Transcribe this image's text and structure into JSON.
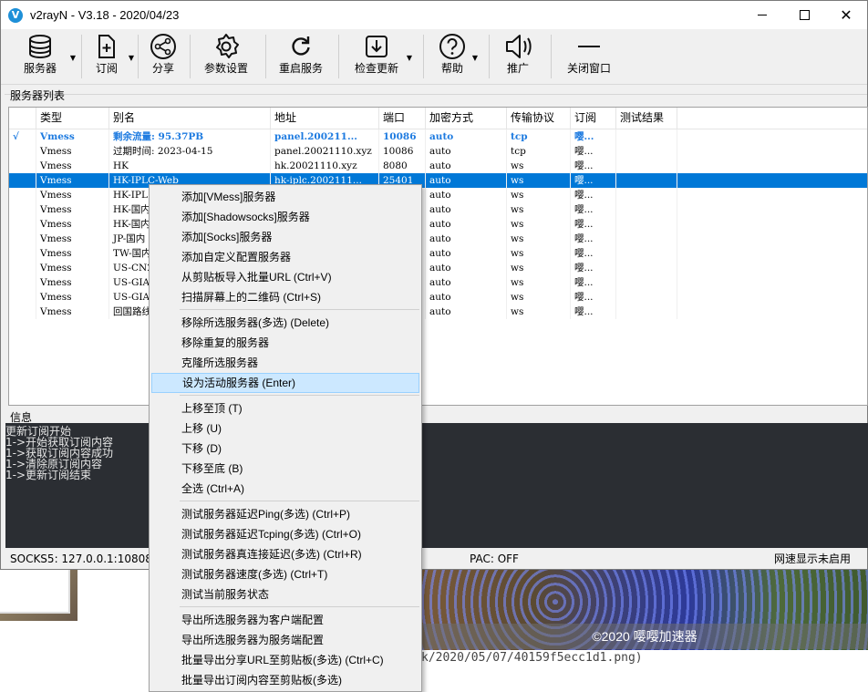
{
  "window": {
    "title": "v2rayN - V3.18 - 2020/04/23",
    "icon_letter": "V"
  },
  "toolbar": [
    {
      "label": "服务器",
      "icon": "database-icon",
      "dropdown": true
    },
    {
      "label": "订阅",
      "icon": "subscribe-icon",
      "dropdown": true
    },
    {
      "label": "分享",
      "icon": "share-icon",
      "dropdown": false
    },
    {
      "label": "参数设置",
      "icon": "gear-icon",
      "dropdown": false
    },
    {
      "label": "重启服务",
      "icon": "refresh-icon",
      "dropdown": false
    },
    {
      "label": "检查更新",
      "icon": "download-icon",
      "dropdown": true
    },
    {
      "label": "帮助",
      "icon": "help-icon",
      "dropdown": true
    },
    {
      "label": "推广",
      "icon": "speaker-icon",
      "dropdown": false
    },
    {
      "label": "关闭窗口",
      "icon": "minus-icon",
      "dropdown": false
    }
  ],
  "server_list": {
    "label": "服务器列表",
    "columns": [
      "",
      "类型",
      "别名",
      "地址",
      "端口",
      "加密方式",
      "传输协议",
      "订阅",
      "测试结果"
    ],
    "rows": [
      {
        "mark": "√",
        "type": "Vmess",
        "alias": "剩余流量: 95.37PB",
        "address": "panel.200211...",
        "port": "10086",
        "security": "auto",
        "network": "tcp",
        "sub": "嘤...",
        "test": "",
        "state": "active"
      },
      {
        "mark": "",
        "type": "Vmess",
        "alias": "过期时间: 2023-04-15",
        "address": "panel.20021110.xyz",
        "port": "10086",
        "security": "auto",
        "network": "tcp",
        "sub": "嘤...",
        "test": "",
        "state": ""
      },
      {
        "mark": "",
        "type": "Vmess",
        "alias": "HK",
        "address": "hk.20021110.xyz",
        "port": "8080",
        "security": "auto",
        "network": "ws",
        "sub": "嘤...",
        "test": "",
        "state": ""
      },
      {
        "mark": "",
        "type": "Vmess",
        "alias": "HK-IPLC-Web",
        "address": "hk-iplc.2002111...",
        "port": "25401",
        "security": "auto",
        "network": "ws",
        "sub": "嘤...",
        "test": "",
        "state": "selected"
      },
      {
        "mark": "",
        "type": "Vmess",
        "alias": "HK-IPL",
        "address": "",
        "port": "",
        "security": "auto",
        "network": "ws",
        "sub": "嘤...",
        "test": "",
        "state": ""
      },
      {
        "mark": "",
        "type": "Vmess",
        "alias": "HK-国内",
        "address": "",
        "port": "",
        "security": "auto",
        "network": "ws",
        "sub": "嘤...",
        "test": "",
        "state": ""
      },
      {
        "mark": "",
        "type": "Vmess",
        "alias": "HK-国内",
        "address": "",
        "port": "",
        "security": "auto",
        "network": "ws",
        "sub": "嘤...",
        "test": "",
        "state": ""
      },
      {
        "mark": "",
        "type": "Vmess",
        "alias": "JP-国内",
        "address": "",
        "port": "",
        "security": "auto",
        "network": "ws",
        "sub": "嘤...",
        "test": "",
        "state": ""
      },
      {
        "mark": "",
        "type": "Vmess",
        "alias": "TW-国内",
        "address": "",
        "port": "",
        "security": "auto",
        "network": "ws",
        "sub": "嘤...",
        "test": "",
        "state": ""
      },
      {
        "mark": "",
        "type": "Vmess",
        "alias": "US-CN2",
        "address": "",
        "port": "",
        "security": "auto",
        "network": "ws",
        "sub": "嘤...",
        "test": "",
        "state": ""
      },
      {
        "mark": "",
        "type": "Vmess",
        "alias": "US-GIA",
        "address": "",
        "port": "",
        "security": "auto",
        "network": "ws",
        "sub": "嘤...",
        "test": "",
        "state": ""
      },
      {
        "mark": "",
        "type": "Vmess",
        "alias": "US-GIA-",
        "address": "",
        "port": "",
        "security": "auto",
        "network": "ws",
        "sub": "嘤...",
        "test": "",
        "state": ""
      },
      {
        "mark": "",
        "type": "Vmess",
        "alias": "回国路线",
        "address": "",
        "port": "",
        "security": "auto",
        "network": "ws",
        "sub": "嘤...",
        "test": "",
        "state": ""
      }
    ]
  },
  "info": {
    "label": "信息",
    "log": "更新订阅开始\n1->开始获取订阅内容\n1->获取订阅内容成功\n1->清除原订阅内容\n1->更新订阅结束"
  },
  "status": {
    "socks": "SOCKS5:  127.0.0.1:10808",
    "pac": "PAC:  OFF",
    "speed": "网速显示未启用"
  },
  "context_menu": {
    "groups": [
      [
        "添加[VMess]服务器",
        "添加[Shadowsocks]服务器",
        "添加[Socks]服务器",
        "添加自定义配置服务器",
        "从剪贴板导入批量URL (Ctrl+V)",
        "扫描屏幕上的二维码 (Ctrl+S)"
      ],
      [
        "移除所选服务器(多选) (Delete)",
        "移除重复的服务器",
        "克隆所选服务器",
        "设为活动服务器 (Enter)"
      ],
      [
        "上移至顶 (T)",
        "上移 (U)",
        "下移 (D)",
        "下移至底 (B)",
        "全选 (Ctrl+A)"
      ],
      [
        "测试服务器延迟Ping(多选) (Ctrl+P)",
        "测试服务器延迟Tcping(多选) (Ctrl+O)",
        "测试服务器真连接延迟(多选) (Ctrl+R)",
        "测试服务器速度(多选) (Ctrl+T)",
        "测试当前服务状态"
      ],
      [
        "导出所选服务器为客户端配置",
        "导出所选服务器为服务端配置",
        "批量导出分享URL至剪贴板(多选) (Ctrl+C)",
        "批量导出订阅内容至剪贴板(多选)"
      ]
    ],
    "highlighted": "设为活动服务器 (Enter)"
  },
  "background": {
    "caption": "©2020 嘤嘤加速器",
    "path_text": "k/2020/05/07/40159f5ecc1d1.png)"
  }
}
